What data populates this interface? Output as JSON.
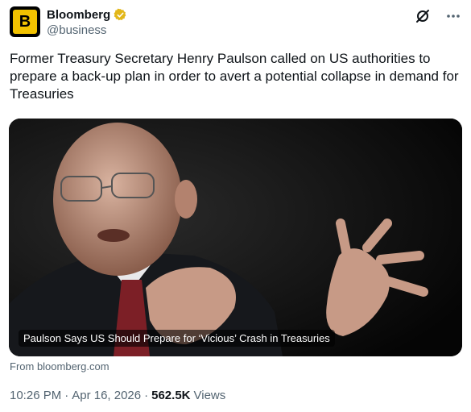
{
  "account": {
    "display_name": "Bloomberg",
    "handle": "@business",
    "avatar_letter": "B",
    "verified_color": "#e2b719"
  },
  "tweet": {
    "text": "Former Treasury Secretary Henry Paulson called on US authorities to prepare a back-up plan in order to avert a potential collapse in demand for Treasuries"
  },
  "card": {
    "caption": "Paulson Says US Should Prepare for ‘Vicious’ Crash in Treasuries",
    "source": "From bloomberg.com"
  },
  "meta": {
    "time": "10:26 PM",
    "separator": "·",
    "date": "Apr 16, 2026",
    "separator2": "·",
    "views_count": "562.5K",
    "views_label": "Views"
  },
  "icons": {
    "grok": "grok-icon",
    "more": "more-icon"
  }
}
